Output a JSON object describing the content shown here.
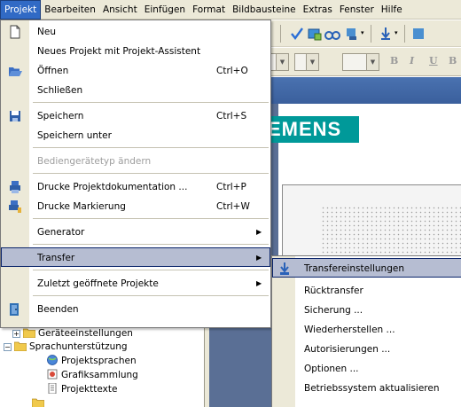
{
  "menubar": {
    "items": [
      "Projekt",
      "Bearbeiten",
      "Ansicht",
      "Einfügen",
      "Format",
      "Bildbausteine",
      "Extras",
      "Fenster",
      "Hilfe"
    ]
  },
  "brand": {
    "logo_text": "EMENS",
    "logo_color": "#009999"
  },
  "toolbar": {
    "format_buttons": [
      "B",
      "I",
      "U",
      "B"
    ]
  },
  "project_menu": {
    "items": [
      {
        "label": "Neu",
        "shortcut": "",
        "icon": "new-document-icon",
        "submenu": false,
        "enabled": true
      },
      {
        "label": "Neues Projekt mit Projekt-Assistent",
        "shortcut": "",
        "icon": "",
        "submenu": false,
        "enabled": true
      },
      {
        "label": "Öffnen",
        "shortcut": "Ctrl+O",
        "icon": "open-folder-icon",
        "submenu": false,
        "enabled": true
      },
      {
        "label": "Schließen",
        "shortcut": "",
        "icon": "",
        "submenu": false,
        "enabled": true
      },
      {
        "label": "Speichern",
        "shortcut": "Ctrl+S",
        "icon": "save-disk-icon",
        "submenu": false,
        "enabled": true
      },
      {
        "label": "Speichern unter",
        "shortcut": "",
        "icon": "",
        "submenu": false,
        "enabled": true
      },
      {
        "label": "Bediengerätetyp ändern",
        "shortcut": "",
        "icon": "",
        "submenu": false,
        "enabled": false
      },
      {
        "label": "Drucke Projektdokumentation ...",
        "shortcut": "Ctrl+P",
        "icon": "print-icon",
        "submenu": false,
        "enabled": true
      },
      {
        "label": "Drucke Markierung",
        "shortcut": "Ctrl+W",
        "icon": "print-selection-icon",
        "submenu": false,
        "enabled": true
      },
      {
        "label": "Generator",
        "shortcut": "",
        "icon": "",
        "submenu": true,
        "enabled": true
      },
      {
        "label": "Transfer",
        "shortcut": "",
        "icon": "",
        "submenu": true,
        "enabled": true,
        "highlighted": true
      },
      {
        "label": "Zuletzt geöffnete Projekte",
        "shortcut": "",
        "icon": "",
        "submenu": true,
        "enabled": true
      },
      {
        "label": "Beenden",
        "shortcut": "",
        "icon": "exit-door-icon",
        "submenu": false,
        "enabled": true
      }
    ]
  },
  "transfer_submenu": {
    "items": [
      {
        "label": "Transfereinstellungen",
        "icon": "transfer-settings-icon",
        "highlighted": true
      },
      {
        "label": "Rücktransfer"
      },
      {
        "label": "Sicherung ..."
      },
      {
        "label": "Wiederherstellen ..."
      },
      {
        "label": "Autorisierungen ..."
      },
      {
        "label": "Optionen ..."
      },
      {
        "label": "Betriebssystem aktualisieren"
      }
    ]
  },
  "tree": {
    "items": [
      {
        "label": "Geräteeinstellungen",
        "icon": "folder-icon"
      },
      {
        "label": "Sprachunterstützung",
        "icon": "folder-icon"
      },
      {
        "label": "Projektsprachen",
        "icon": "globe-icon"
      },
      {
        "label": "Grafiksammlung",
        "icon": "graphics-icon"
      },
      {
        "label": "Projekttexte",
        "icon": "text-document-icon"
      }
    ]
  }
}
